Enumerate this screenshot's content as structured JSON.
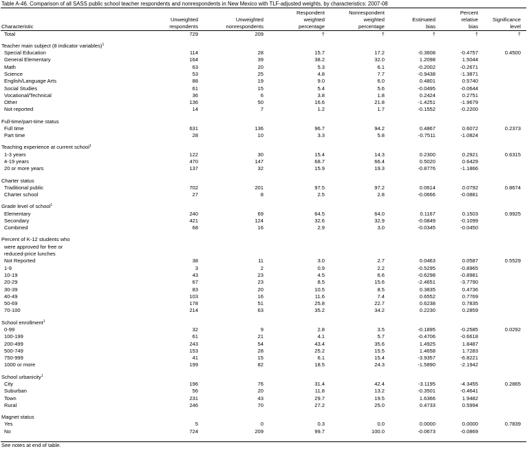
{
  "title": "Table A-46. Comparison of all SASS public school teacher respondents and nonrespondents in New Mexico with TLF-adjusted weights, by characteristics: 2007-08",
  "header": {
    "characteristic": "Characteristic",
    "columns": [
      [
        "",
        "Unweighted",
        "respondents"
      ],
      [
        "",
        "Unweighted",
        "nonrespondents"
      ],
      [
        "Respondent",
        "weighted",
        "percentage"
      ],
      [
        "Nonrespondent",
        "weighted",
        "percentage"
      ],
      [
        "",
        "Estimated",
        "bias"
      ],
      [
        "Percent",
        "relative",
        "bias"
      ],
      [
        "",
        "Significance",
        "level"
      ]
    ]
  },
  "rows": [
    {
      "label": "Total",
      "indent": 1,
      "vals": [
        "729",
        "209",
        "†",
        "†",
        "†",
        "†",
        "†"
      ]
    },
    {
      "gap": true
    },
    {
      "label": "Teacher main subject (8 indicator variables)",
      "sup": "1",
      "indent": 0,
      "vals": []
    },
    {
      "label": "Special Education",
      "indent": 1,
      "vals": [
        "114",
        "28",
        "15.7",
        "17.2",
        "-0.3608",
        "-0.4757",
        "0.4500"
      ]
    },
    {
      "label": "General Elementary",
      "indent": 1,
      "vals": [
        "164",
        "39",
        "38.2",
        "32.0",
        "1.2098",
        "1.5044",
        ""
      ]
    },
    {
      "label": "Math",
      "indent": 1,
      "vals": [
        "63",
        "20",
        "5.3",
        "6.1",
        "-0.2002",
        "-0.2671",
        ""
      ]
    },
    {
      "label": "Science",
      "indent": 1,
      "vals": [
        "53",
        "25",
        "4.8",
        "7.7",
        "-0.9438",
        "-1.3871",
        ""
      ]
    },
    {
      "label": "English/Language Arts",
      "indent": 1,
      "vals": [
        "88",
        "19",
        "9.0",
        "6.0",
        "0.4801",
        "0.5740",
        ""
      ]
    },
    {
      "label": "Social Studies",
      "indent": 1,
      "vals": [
        "61",
        "15",
        "5.4",
        "5.6",
        "-0.0495",
        "-0.0644",
        ""
      ]
    },
    {
      "label": "Vocational/Technical",
      "indent": 1,
      "vals": [
        "36",
        "6",
        "3.8",
        "1.8",
        "0.2424",
        "0.2751",
        ""
      ]
    },
    {
      "label": "Other",
      "indent": 1,
      "vals": [
        "136",
        "50",
        "16.6",
        "21.8",
        "-1.4251",
        "-1.9679",
        ""
      ]
    },
    {
      "label": "Not reported",
      "indent": 1,
      "vals": [
        "14",
        "7",
        "1.2",
        "1.7",
        "-0.1552",
        "-0.2200",
        ""
      ]
    },
    {
      "gap": true
    },
    {
      "label": "Full-time/part-time status",
      "indent": 0,
      "vals": []
    },
    {
      "label": "Full time",
      "indent": 1,
      "vals": [
        "631",
        "136",
        "96.7",
        "94.2",
        "0.4867",
        "0.6072",
        "0.2373"
      ]
    },
    {
      "label": "Part time",
      "indent": 1,
      "vals": [
        "28",
        "10",
        "3.3",
        "5.8",
        "-0.7511",
        "-1.0824",
        ""
      ]
    },
    {
      "gap": true
    },
    {
      "label": "Teaching experience at current school",
      "sup": "1",
      "indent": 0,
      "vals": []
    },
    {
      "label": "1-3 years",
      "indent": 1,
      "vals": [
        "122",
        "30",
        "15.4",
        "14.3",
        "0.2300",
        "0.2921",
        "0.6315"
      ]
    },
    {
      "label": "4-19 years",
      "indent": 1,
      "vals": [
        "470",
        "147",
        "68.7",
        "66.4",
        "0.5020",
        "0.6429",
        ""
      ]
    },
    {
      "label": "20 or more years",
      "indent": 1,
      "vals": [
        "137",
        "32",
        "15.9",
        "19.3",
        "-0.8776",
        "-1.1866",
        ""
      ]
    },
    {
      "gap": true
    },
    {
      "label": "Charter status",
      "indent": 0,
      "vals": []
    },
    {
      "label": "Traditional public",
      "indent": 1,
      "vals": [
        "702",
        "201",
        "97.5",
        "97.2",
        "0.0614",
        "0.0792",
        "0.8674"
      ]
    },
    {
      "label": "Charter school",
      "indent": 1,
      "vals": [
        "27",
        "8",
        "2.5",
        "2.8",
        "-0.0666",
        "-0.0881",
        ""
      ]
    },
    {
      "gap": true
    },
    {
      "label": "Grade level of school",
      "sup": "1",
      "indent": 0,
      "vals": []
    },
    {
      "label": "Elementary",
      "indent": 1,
      "vals": [
        "240",
        "69",
        "64.5",
        "64.0",
        "0.1167",
        "0.1503",
        "0.9925"
      ]
    },
    {
      "label": "Secondary",
      "indent": 1,
      "vals": [
        "421",
        "124",
        "32.6",
        "32.9",
        "-0.0849",
        "-0.1099",
        ""
      ]
    },
    {
      "label": "Combined",
      "indent": 1,
      "vals": [
        "68",
        "16",
        "2.9",
        "3.0",
        "-0.0345",
        "-0.0450",
        ""
      ]
    },
    {
      "gap": true
    },
    {
      "label": "Percent of K-12 students who",
      "indent": 0,
      "vals": []
    },
    {
      "label": "were approved for free or",
      "indent": 1,
      "vals": []
    },
    {
      "label": "reduced-price lunches",
      "indent": 1,
      "vals": []
    },
    {
      "label": "Not Reported",
      "indent": 1,
      "vals": [
        "38",
        "11",
        "3.0",
        "2.7",
        "0.0463",
        "0.0587",
        "0.5529"
      ]
    },
    {
      "label": "1-9",
      "indent": 1,
      "vals": [
        "3",
        "2",
        "0.9",
        "2.2",
        "-0.5295",
        "-0.8965",
        ""
      ]
    },
    {
      "label": "10-19",
      "indent": 1,
      "vals": [
        "43",
        "23",
        "4.5",
        "6.6",
        "-0.6298",
        "-0.8981",
        ""
      ]
    },
    {
      "label": "20-29",
      "indent": 1,
      "vals": [
        "67",
        "23",
        "8.5",
        "15.6",
        "-2.4651",
        "-3.7790",
        ""
      ]
    },
    {
      "label": "30-39",
      "indent": 1,
      "vals": [
        "83",
        "20",
        "10.5",
        "8.5",
        "0.3835",
        "0.4736",
        ""
      ]
    },
    {
      "label": "40-49",
      "indent": 1,
      "vals": [
        "103",
        "16",
        "11.6",
        "7.4",
        "0.6552",
        "0.7769",
        ""
      ]
    },
    {
      "label": "50-69",
      "indent": 1,
      "vals": [
        "178",
        "51",
        "25.8",
        "22.7",
        "0.6238",
        "0.7835",
        ""
      ]
    },
    {
      "label": "70-100",
      "indent": 1,
      "vals": [
        "214",
        "63",
        "35.2",
        "34.2",
        "0.2230",
        "0.2859",
        ""
      ]
    },
    {
      "gap": true
    },
    {
      "label": "School enrollment",
      "sup": "1",
      "indent": 0,
      "vals": []
    },
    {
      "label": "0-99",
      "indent": 1,
      "vals": [
        "32",
        "9",
        "2.8",
        "3.5",
        "-0.1895",
        "-0.2585",
        "0.0292"
      ]
    },
    {
      "label": "100-199",
      "indent": 1,
      "vals": [
        "61",
        "21",
        "4.1",
        "5.7",
        "-0.4706",
        "-0.6618",
        ""
      ]
    },
    {
      "label": "200-499",
      "indent": 1,
      "vals": [
        "243",
        "54",
        "43.4",
        "35.6",
        "1.4925",
        "1.8487",
        ""
      ]
    },
    {
      "label": "500-749",
      "indent": 1,
      "vals": [
        "153",
        "28",
        "25.2",
        "15.5",
        "1.4658",
        "1.7283",
        ""
      ]
    },
    {
      "label": "750-999",
      "indent": 1,
      "vals": [
        "41",
        "15",
        "6.1",
        "15.4",
        "-3.9357",
        "-6.8221",
        ""
      ]
    },
    {
      "label": "1000 or more",
      "indent": 1,
      "vals": [
        "199",
        "82",
        "18.5",
        "24.3",
        "-1.5890",
        "-2.1942",
        ""
      ]
    },
    {
      "gap": true
    },
    {
      "label": "School urbanicity",
      "sup": "1",
      "indent": 0,
      "vals": []
    },
    {
      "label": "City",
      "indent": 1,
      "vals": [
        "196",
        "76",
        "31.4",
        "42.4",
        "-3.1195",
        "-4.3455",
        "0.2865"
      ]
    },
    {
      "label": "Suburban",
      "indent": 1,
      "vals": [
        "56",
        "20",
        "11.8",
        "13.2",
        "-0.3501",
        "-0.4641",
        ""
      ]
    },
    {
      "label": "Town",
      "indent": 1,
      "vals": [
        "231",
        "43",
        "29.7",
        "19.5",
        "1.6366",
        "1.9482",
        ""
      ]
    },
    {
      "label": "Rural",
      "indent": 1,
      "vals": [
        "246",
        "70",
        "27.2",
        "25.0",
        "0.4733",
        "0.5994",
        ""
      ]
    },
    {
      "gap": true
    },
    {
      "label": "Magnet status",
      "indent": 0,
      "vals": []
    },
    {
      "label": "Yes",
      "indent": 1,
      "vals": [
        "5",
        "0",
        "0.3",
        "0.0",
        "0.0000",
        "0.0000",
        "0.7839"
      ]
    },
    {
      "label": "No",
      "indent": 1,
      "vals": [
        "724",
        "209",
        "99.7",
        "100.0",
        "-0.0673",
        "-0.0869",
        ""
      ]
    }
  ],
  "footnote": "See notes at end of table."
}
